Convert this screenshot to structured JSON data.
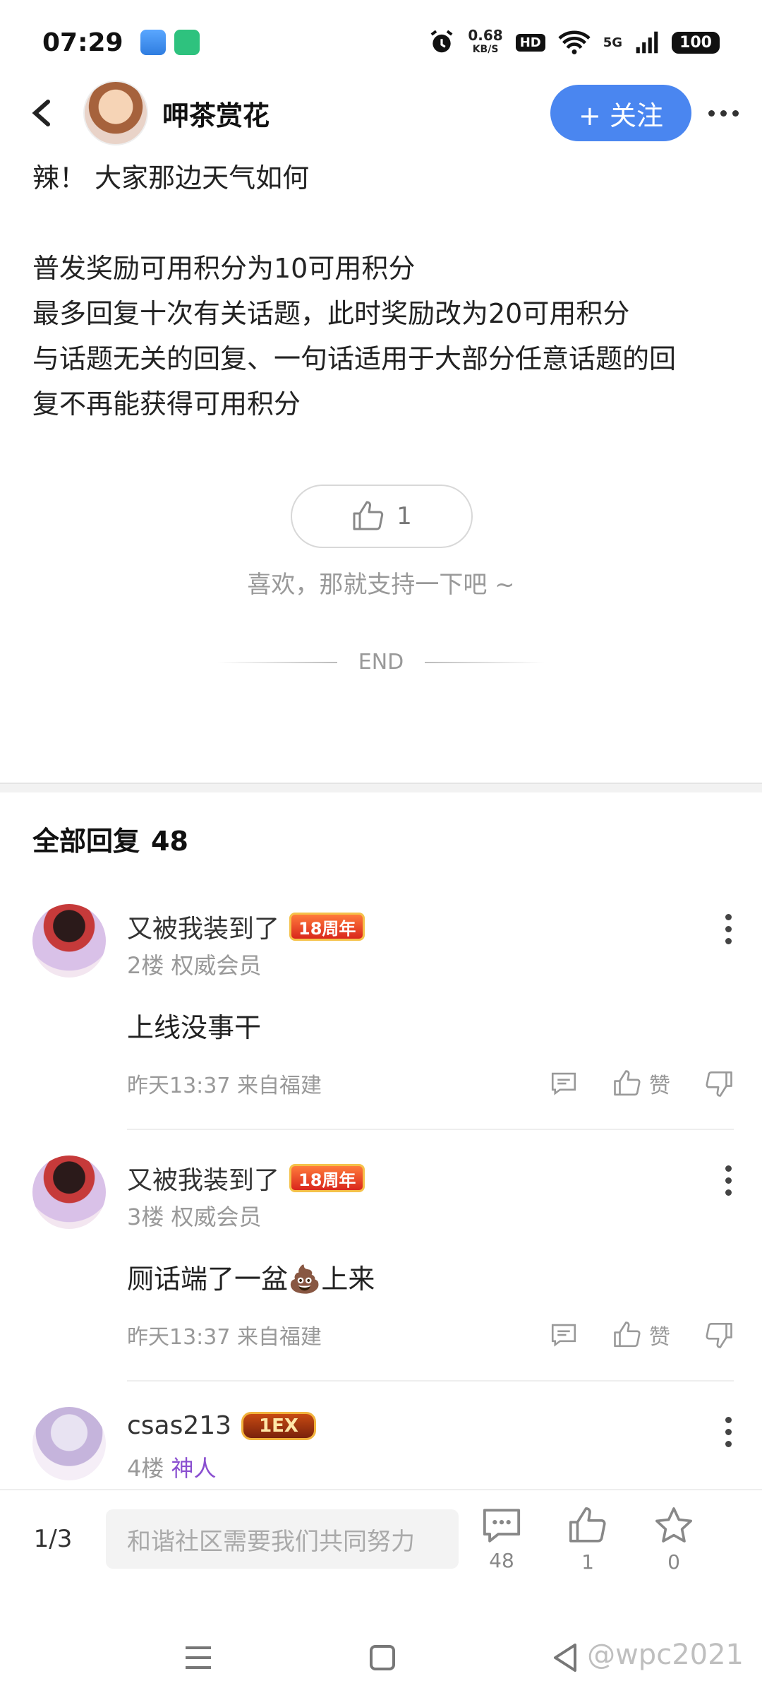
{
  "status_bar": {
    "time": "07:29",
    "net_speed": "0.68",
    "net_unit": "KB/S",
    "hd": "HD",
    "network": "5G",
    "battery": "100"
  },
  "header": {
    "author": "呷茶赏花",
    "follow_label": "+ 关注"
  },
  "post": {
    "lines": [
      "辣！  大家那边天气如何",
      "",
      "普发奖励可用积分为10可用积分",
      "最多回复十次有关话题，此时奖励改为20可用积分",
      "与话题无关的回复、一句话适用于大部分任意话题的回",
      "复不再能获得可用积分"
    ],
    "like_count": "1",
    "support_text": "喜欢，那就支持一下吧 ~",
    "end_label": "END"
  },
  "replies": {
    "title": "全部回复",
    "count": "48",
    "items": [
      {
        "name": "又被我装到了",
        "badge": "18周年",
        "floor": "2楼",
        "rank": "权威会员",
        "text": "上线没事干",
        "time": "昨天13:37 来自福建",
        "like_label": "赞"
      },
      {
        "name": "又被我装到了",
        "badge": "18周年",
        "floor": "3楼",
        "rank": "权威会员",
        "text": "厕话端了一盆💩上来",
        "time": "昨天13:37 来自福建",
        "like_label": "赞"
      },
      {
        "name": "csas213",
        "badge": "1EX",
        "floor": "4楼",
        "rank": "神人"
      }
    ]
  },
  "bottom_bar": {
    "page": "1/3",
    "input_placeholder": "和谐社区需要我们共同努力",
    "comments": "48",
    "likes": "1",
    "favorites": "0"
  },
  "watermark": "@wpc2021",
  "colors": {
    "accent": "#4a86f0",
    "god_rank": "#8a4fd0"
  }
}
